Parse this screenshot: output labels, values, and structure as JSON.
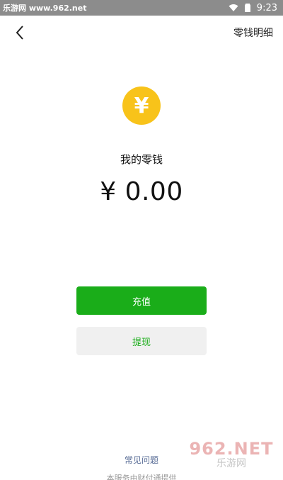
{
  "status_bar": {
    "site_label": "乐游网 www.962.net",
    "time": "9:23"
  },
  "header": {
    "back_icon": "chevron-left-icon",
    "detail_link": "零钱明细"
  },
  "wallet": {
    "coin_symbol": "¥",
    "label": "我的零钱",
    "balance": "¥ 0.00"
  },
  "actions": {
    "topup_label": "充值",
    "withdraw_label": "提现"
  },
  "footer": {
    "faq_label": "常见问题",
    "service_note": "本服务由财付通提供"
  },
  "watermark": {
    "top": "962.NET",
    "bottom": "乐游网"
  },
  "colors": {
    "accent_green": "#1aad19",
    "coin_yellow": "#f8c31a",
    "link_blue": "#576b95"
  }
}
